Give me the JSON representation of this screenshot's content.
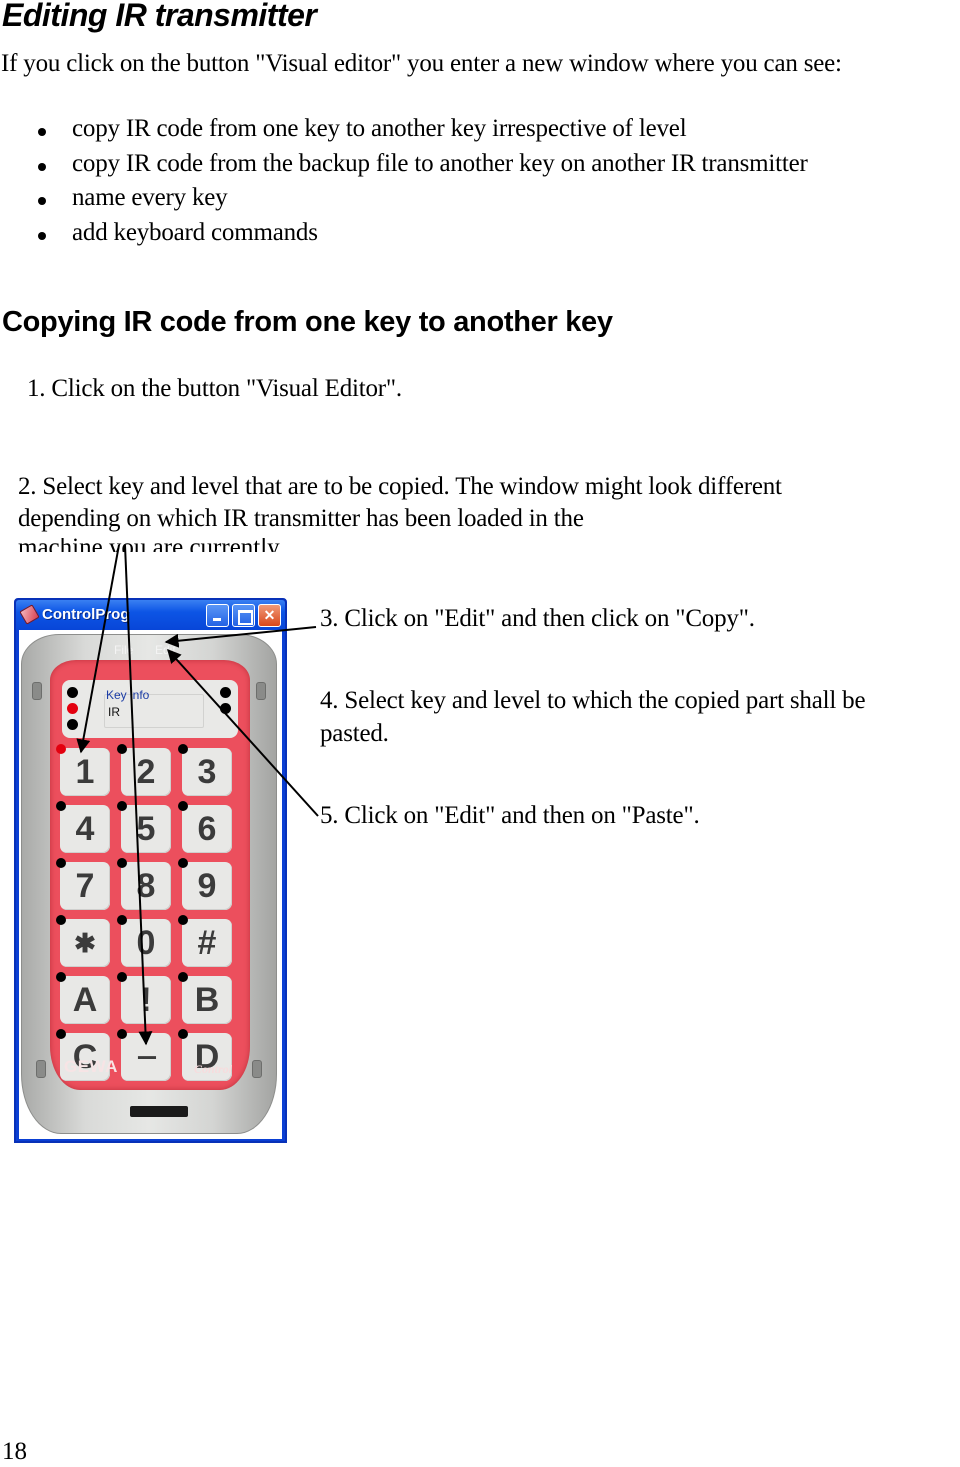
{
  "heading": "Editing IR transmitter",
  "intro": "If you click on the button \"Visual editor\" you enter a new window where you can see:",
  "bullets": [
    "copy IR code from one key to another key irrespective of level",
    "copy IR code from the backup file to another key on another IR transmitter",
    "name every key",
    "add keyboard commands"
  ],
  "section_heading": "Copying IR code from one key to another key",
  "steps": {
    "step1": "1. Click on the button \"Visual Editor\".",
    "step2": "2. Select key and level that are to be copied. The window might look different depending on which IR transmitter has been loaded  in the",
    "step2_clipped": "machine you are currently",
    "step3": "3. Click on \"Edit\" and then click on \"Copy\".",
    "step4": "4. Select key and level to which the copied part shall be pasted.",
    "step5": "5. Click on \"Edit\" and then on \"Paste\"."
  },
  "window": {
    "title": "ControlProg",
    "close_glyph": "✕",
    "menu": {
      "file": "File",
      "edit": "Edit"
    },
    "key_info_label": "Key info",
    "key_info_value": "IR",
    "brand": "GEWA",
    "model": "Control",
    "keys": [
      "1",
      "2",
      "3",
      "4",
      "5",
      "6",
      "7",
      "8",
      "9",
      "✱",
      "0",
      "#",
      "A",
      "!",
      "B",
      "C",
      "---",
      "D"
    ],
    "selected_key": "1",
    "colors": {
      "face": "#ec4f5d",
      "title_bar": "#0d55e5",
      "selected_led": "#e3000f"
    }
  },
  "page_number": "18"
}
